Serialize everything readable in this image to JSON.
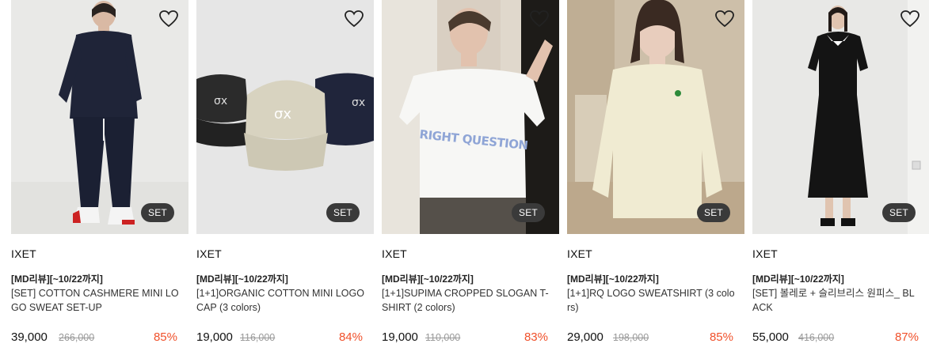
{
  "products": [
    {
      "brand": "IXET",
      "tag": "[MD리뷰][~10/22까지]",
      "name": "[SET] COTTON CASHMERE MINI LOGO SWEAT SET-UP",
      "price": "39,000",
      "original_price": "266,000",
      "discount": "85%",
      "badge": "SET",
      "wishlist_icon": "heart-outline-icon",
      "colors": {
        "bg": "#e9e9e7",
        "item": "#1f2438"
      }
    },
    {
      "brand": "IXET",
      "tag": "[MD리뷰][~10/22까지]",
      "name": "[1+1]ORGANIC COTTON MINI LOGO CAP (3 colors)",
      "price": "19,000",
      "original_price": "116,000",
      "discount": "84%",
      "badge": "SET",
      "wishlist_icon": "heart-outline-icon",
      "colors": {
        "bg": "#e6e6e6",
        "item": "#d7d2bf"
      }
    },
    {
      "brand": "IXET",
      "tag": "[MD리뷰][~10/22까지]",
      "name": "[1+1]SUPIMA CROPPED SLOGAN T-SHIRT (2 colors)",
      "price": "19,000",
      "original_price": "110,000",
      "discount": "83%",
      "badge": "SET",
      "wishlist_icon": "heart-outline-icon",
      "print_text": "RIGHT QUESTION",
      "colors": {
        "bg": "#d9cfc2",
        "item": "#f7f7f5"
      }
    },
    {
      "brand": "IXET",
      "tag": "[MD리뷰][~10/22까지]",
      "name": "[1+1]RQ LOGO SWEATSHIRT (3 colors)",
      "price": "29,000",
      "original_price": "198,000",
      "discount": "85%",
      "badge": "SET",
      "wishlist_icon": "heart-outline-icon",
      "colors": {
        "bg": "#cdbfa9",
        "item": "#f0ebd2"
      }
    },
    {
      "brand": "IXET",
      "tag": "[MD리뷰][~10/22까지]",
      "name": "[SET] 볼레로 + 슬리브리스 원피스_ BLACK",
      "price": "55,000",
      "original_price": "416,000",
      "discount": "87%",
      "badge": "SET",
      "wishlist_icon": "heart-outline-icon",
      "colors": {
        "bg": "#e8e8e6",
        "item": "#141414"
      }
    }
  ]
}
